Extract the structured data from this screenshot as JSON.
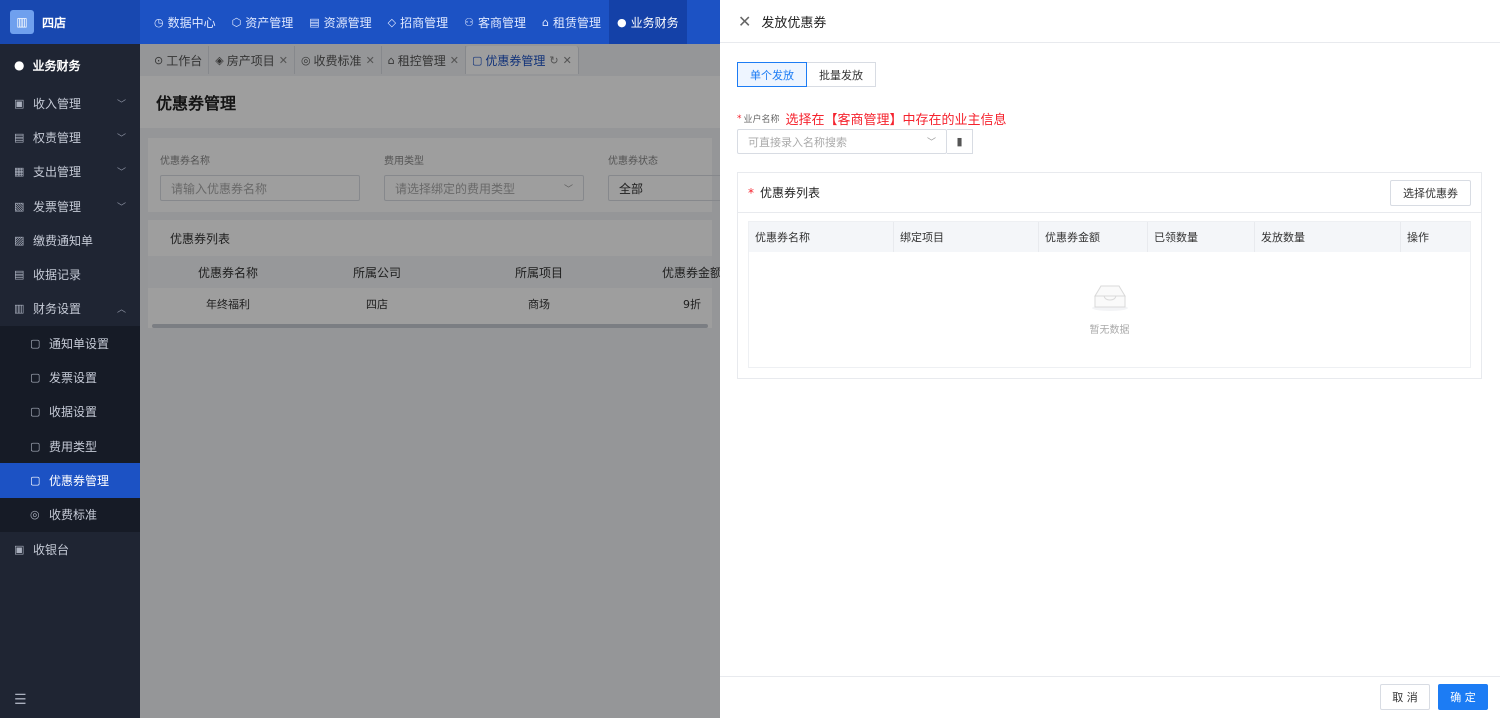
{
  "header": {
    "logo_icon": "building-icon",
    "app_name": "四店",
    "nav": [
      {
        "label": "数据中心",
        "icon": "clock-icon",
        "active": false
      },
      {
        "label": "资产管理",
        "icon": "cube-icon",
        "active": false
      },
      {
        "label": "资源管理",
        "icon": "document-icon",
        "active": false
      },
      {
        "label": "招商管理",
        "icon": "tag-icon",
        "active": false
      },
      {
        "label": "客商管理",
        "icon": "users-icon",
        "active": false
      },
      {
        "label": "租赁管理",
        "icon": "home-icon",
        "active": false
      },
      {
        "label": "业务财务",
        "icon": "finance-icon",
        "active": true
      }
    ]
  },
  "sidebar": {
    "title": "业务财务",
    "items": [
      {
        "label": "收入管理",
        "has_children": true
      },
      {
        "label": "权责管理",
        "has_children": true
      },
      {
        "label": "支出管理",
        "has_children": true
      },
      {
        "label": "发票管理",
        "has_children": true
      },
      {
        "label": "缴费通知单",
        "has_children": false
      },
      {
        "label": "收据记录",
        "has_children": false
      },
      {
        "label": "财务设置",
        "has_children": true,
        "expanded": true
      }
    ],
    "sub_items": [
      {
        "label": "通知单设置",
        "active": false
      },
      {
        "label": "发票设置",
        "active": false
      },
      {
        "label": "收据设置",
        "active": false
      },
      {
        "label": "费用类型",
        "active": false
      },
      {
        "label": "优惠券管理",
        "active": true
      },
      {
        "label": "收费标准",
        "active": false
      }
    ],
    "last_item": "收银台"
  },
  "tabs": [
    {
      "label": "工作台",
      "closable": false,
      "active": false
    },
    {
      "label": "房产项目",
      "closable": true,
      "active": false
    },
    {
      "label": "收费标准",
      "closable": true,
      "active": false
    },
    {
      "label": "租控管理",
      "closable": true,
      "active": false
    },
    {
      "label": "优惠券管理",
      "closable": true,
      "active": true
    }
  ],
  "page": {
    "title": "优惠券管理",
    "filters": [
      {
        "label": "优惠券名称",
        "placeholder": "请输入优惠券名称"
      },
      {
        "label": "费用类型",
        "placeholder": "请选择绑定的费用类型"
      },
      {
        "label": "优惠券状态",
        "value": "全部"
      }
    ],
    "list_title": "优惠券列表",
    "columns": [
      "优惠券名称",
      "所属公司",
      "所属项目",
      "优惠券金额"
    ],
    "rows": [
      [
        "年终福利",
        "四店",
        "商场",
        "9折"
      ]
    ]
  },
  "drawer": {
    "title": "发放优惠券",
    "modes": [
      {
        "label": "单个发放",
        "active": true
      },
      {
        "label": "批量发放",
        "active": false
      }
    ],
    "owner_label": "业户名称",
    "owner_note": "选择在【客商管理】中存在的业主信息",
    "owner_placeholder": "可直接录入名称搜索",
    "coupon_list_title": "优惠券列表",
    "choose_button": "选择优惠券",
    "columns": [
      "优惠券名称",
      "绑定项目",
      "优惠券金额",
      "已领数量",
      "发放数量",
      "操作"
    ],
    "empty_text": "暂无数据",
    "cancel": "取 消",
    "confirm": "确 定"
  }
}
